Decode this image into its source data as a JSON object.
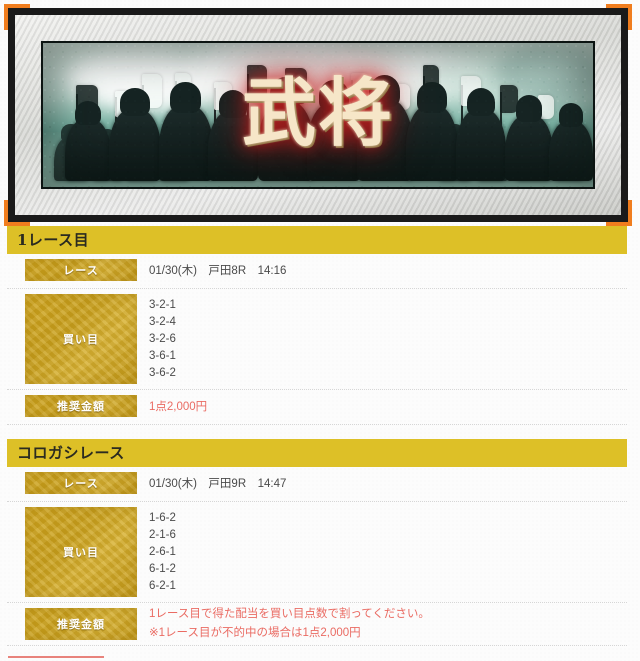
{
  "banner": {
    "title": "武将",
    "alt": "samurai-cavalry-banner"
  },
  "sections": [
    {
      "header": "1レース目",
      "rows": [
        {
          "label": "レース",
          "lines": [
            "01/30(木)　戸田8R　14:16"
          ],
          "accent": false,
          "kind": "race"
        },
        {
          "label": "買い目",
          "lines": [
            "3-2-1",
            "3-2-4",
            "3-2-6",
            "3-6-1",
            "3-6-2"
          ],
          "accent": false,
          "kind": "kaime"
        },
        {
          "label": "推奨金額",
          "lines": [
            "1点2,000円"
          ],
          "accent": true,
          "kind": "kingaku"
        }
      ]
    },
    {
      "header": "コロガシレース",
      "rows": [
        {
          "label": "レース",
          "lines": [
            "01/30(木)　戸田9R　14:47"
          ],
          "accent": false,
          "kind": "race"
        },
        {
          "label": "買い目",
          "lines": [
            "1-6-2",
            "2-1-6",
            "2-6-1",
            "6-1-2",
            "6-2-1"
          ],
          "accent": false,
          "kind": "kaime"
        },
        {
          "label": "推奨金額",
          "lines": [
            "1レース目で得た配当を買い目点数で割ってください。",
            "※1レース目が不的中の場合は1点2,000円"
          ],
          "accent": true,
          "kind": "kingaku2"
        }
      ]
    }
  ],
  "colors": {
    "section_header_bg": "#ddc027",
    "label_cell_gold": "#c9a01b",
    "accent_red": "#ea6b63",
    "corner_orange": "#f07d1e",
    "footer_rule": "#e8837c"
  }
}
